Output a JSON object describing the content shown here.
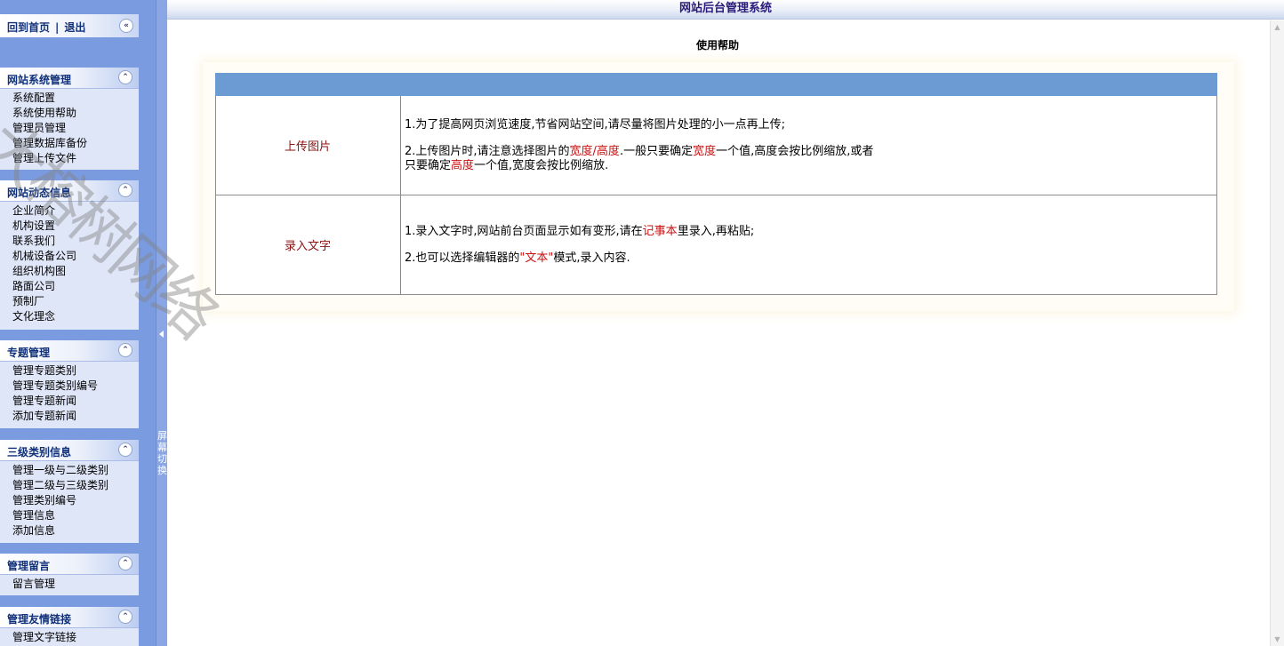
{
  "app": {
    "title": "网站后台管理系统"
  },
  "topbar": {
    "home_link": "回到首页",
    "separator": "|",
    "logout_link": "退出",
    "collapse_glyph": "«"
  },
  "sidebar": {
    "collapse_glyph": "⌃",
    "menus": [
      {
        "title": "网站系统管理",
        "items": [
          "系统配置",
          "系统使用帮助",
          "管理员管理",
          "管理数据库备份",
          "管理上传文件"
        ]
      },
      {
        "title": "网站动态信息",
        "items": [
          "企业简介",
          "机构设置",
          "联系我们",
          "机械设备公司",
          "组织机构图",
          "路面公司",
          "预制厂",
          "文化理念"
        ]
      },
      {
        "title": "专题管理",
        "items": [
          "管理专题类别",
          "管理专题类别编号",
          "管理专题新闻",
          "添加专题新闻"
        ]
      },
      {
        "title": "三级类别信息",
        "items": [
          "管理一级与二级类别",
          "管理二级与三级类别",
          "管理类别编号",
          "管理信息",
          "添加信息"
        ]
      },
      {
        "title": "管理留言",
        "items": [
          "留言管理"
        ]
      },
      {
        "title": "管理友情链接",
        "items": [
          "管理文字链接"
        ]
      }
    ]
  },
  "splitter": {
    "label": "屏幕切换"
  },
  "main": {
    "heading": "使用帮助",
    "rows": [
      {
        "label": "上传图片",
        "lines": {
          "l1": "1.为了提高网页浏览速度,节省网站空间,请尽量将图片处理的小一点再上传;",
          "l2_a": "2.上传图片时,请注意选择图片的",
          "l2_red1": "宽度/高度",
          "l2_b": ".一般只要确定",
          "l2_red2": "宽度",
          "l2_c": "一个值,高度会按比例缩放,或者",
          "l2_d": "只要确定",
          "l2_red3": "高度",
          "l2_e": "一个值,宽度会按比例缩放."
        }
      },
      {
        "label": "录入文字",
        "lines": {
          "l1_a": "1.录入文字时,网站前台页面显示如有变形,请在",
          "l1_red": "记事本",
          "l1_b": "里录入,再粘贴;",
          "l2_a": "2.也可以选择编辑器的",
          "l2_red": "\"文本\"",
          "l2_b": "模式,录入内容."
        }
      }
    ]
  },
  "watermark": {
    "text": "大榕树网络"
  },
  "colors": {
    "sidebar_bg": "#7b9be0",
    "menu_bg": "#dfe6f8",
    "menu_title": "#10307a",
    "table_header": "#6c9ad2",
    "label_text": "#8b1010",
    "highlight_red": "#cc1111",
    "app_title": "#2a1a7a"
  }
}
